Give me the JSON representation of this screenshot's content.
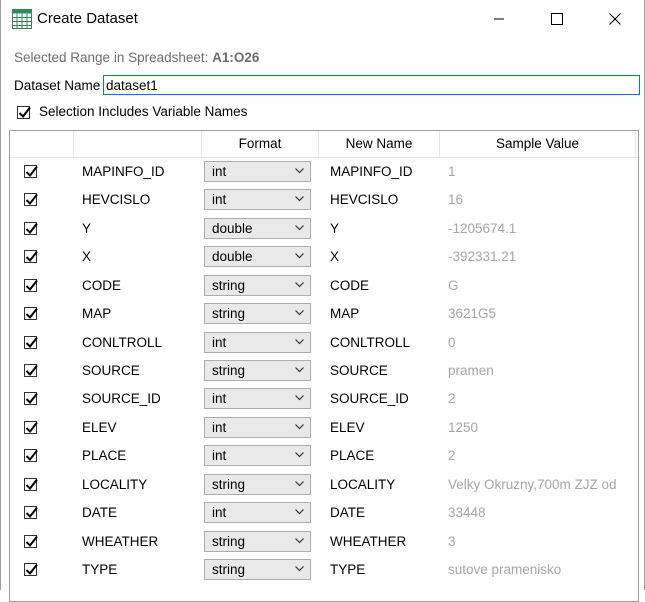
{
  "window": {
    "title": "Create Dataset"
  },
  "range": {
    "label": "Selected Range in Spreadsheet:",
    "value": "A1:O26"
  },
  "dataset": {
    "label": "Dataset Name",
    "value": "dataset1"
  },
  "includes_names": {
    "label": "Selection Includes Variable Names",
    "checked": true
  },
  "columns": {
    "format": "Format",
    "new_name": "New Name",
    "sample": "Sample Value"
  },
  "rows": [
    {
      "name": "MAPINFO_ID",
      "format": "int",
      "new_name": "MAPINFO_ID",
      "sample": "1",
      "checked": true
    },
    {
      "name": "HEVCISLO",
      "format": "int",
      "new_name": "HEVCISLO",
      "sample": "16",
      "checked": true
    },
    {
      "name": "Y",
      "format": "double",
      "new_name": "Y",
      "sample": "-1205674.1",
      "checked": true
    },
    {
      "name": "X",
      "format": "double",
      "new_name": "X",
      "sample": "-392331.21",
      "checked": true
    },
    {
      "name": "CODE",
      "format": "string",
      "new_name": "CODE",
      "sample": "G",
      "checked": true
    },
    {
      "name": "MAP",
      "format": "string",
      "new_name": "MAP",
      "sample": "3621G5",
      "checked": true
    },
    {
      "name": "CONLTROLL",
      "format": "int",
      "new_name": "CONLTROLL",
      "sample": "0",
      "checked": true
    },
    {
      "name": "SOURCE",
      "format": "string",
      "new_name": "SOURCE",
      "sample": "pramen",
      "checked": true
    },
    {
      "name": "SOURCE_ID",
      "format": "int",
      "new_name": "SOURCE_ID",
      "sample": "2",
      "checked": true
    },
    {
      "name": "ELEV",
      "format": "int",
      "new_name": "ELEV",
      "sample": "1250",
      "checked": true
    },
    {
      "name": "PLACE",
      "format": "int",
      "new_name": "PLACE",
      "sample": "2",
      "checked": true
    },
    {
      "name": "LOCALITY",
      "format": "string",
      "new_name": "LOCALITY",
      "sample": "Velky Okruzny,700m ZJZ od",
      "checked": true
    },
    {
      "name": "DATE",
      "format": "int",
      "new_name": "DATE",
      "sample": "33448",
      "checked": true
    },
    {
      "name": "WHEATHER",
      "format": "string",
      "new_name": "WHEATHER",
      "sample": "3",
      "checked": true
    },
    {
      "name": "TYPE",
      "format": "string",
      "new_name": "TYPE",
      "sample": "sutove pramenisko",
      "checked": true
    }
  ],
  "icons": {
    "app": "spreadsheet-grid-icon",
    "minimize": "minimize-icon",
    "maximize": "maximize-icon",
    "close": "close-icon",
    "check": "checkmark-icon",
    "dropdown": "chevron-down-icon"
  },
  "colors": {
    "accent": "#0078d7",
    "grid_icon": "#2e8b57",
    "sample_text": "#a6a6a6"
  }
}
